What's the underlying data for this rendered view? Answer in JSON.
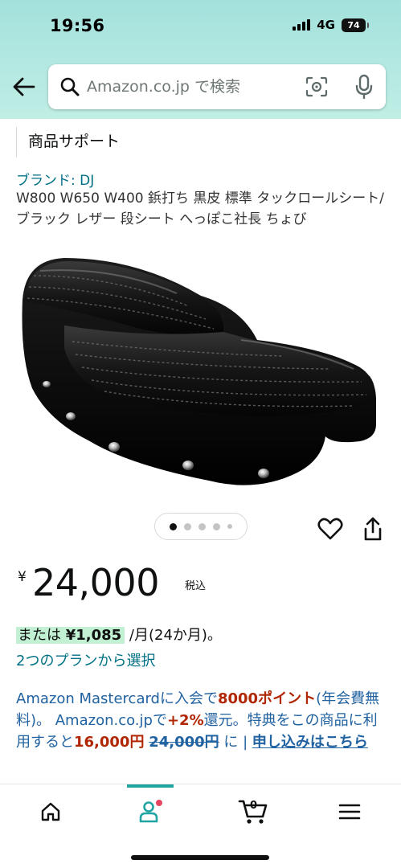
{
  "status_bar": {
    "time": "19:56",
    "network": "4G",
    "battery": "74"
  },
  "search": {
    "placeholder": "Amazon.co.jp で検索"
  },
  "page": {
    "support_label": "商品サポート",
    "brand": "ブランド: DJ",
    "title": "W800 W650 W400 鋲打ち 黒皮 標準 タックロールシート/ブラック レザー 段シート へっぽこ社長 ちょび",
    "price_yen": "¥",
    "price": "24,000",
    "tax_label": "税込",
    "installment_prefix": "または ",
    "installment_amount": "¥1,085",
    "installment_suffix": " /月(24か月)。",
    "plan_link": "2つのプランから選択"
  },
  "promo": {
    "part1": "Amazon Mastercardに入会で",
    "points": "8000ポイント",
    "part2": "(年会費無料)。 Amazon.co.jpで",
    "rate": "+2%",
    "part3": "還元。特典をこの商品に利用すると",
    "new_price": "16,000円",
    "old_price": "24,000円",
    "part4": " に | ",
    "apply_link": "申し込みはこちら"
  },
  "carousel": {
    "count": 5,
    "active_index": 0
  },
  "colors": {
    "header_bg": "#a3e1dc",
    "link": "#007185",
    "price_red": "#b12704",
    "nav_accent": "#21a5a2",
    "installment_highlight": "#c2f0d2"
  },
  "bottom_nav": {
    "items": [
      "home-icon",
      "account-icon",
      "cart-icon",
      "menu-icon"
    ],
    "cart_count": "0",
    "active": "account-icon"
  }
}
